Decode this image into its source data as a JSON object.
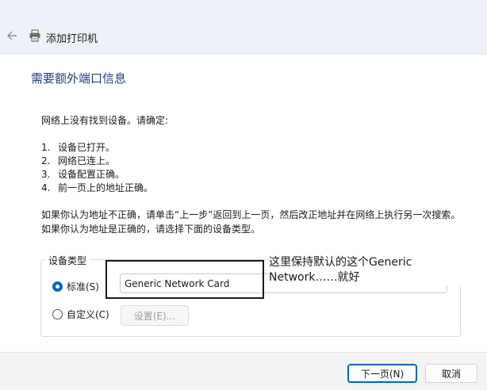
{
  "window": {
    "title": "添加打印机",
    "back_icon": "back-arrow-icon",
    "title_icon": "printer-icon"
  },
  "main": {
    "heading": "需要额外端口信息",
    "intro": "网络上没有找到设备。请确定:",
    "checklist": [
      {
        "num": "1.",
        "text": "设备已打开。"
      },
      {
        "num": "2.",
        "text": "网络已连上。"
      },
      {
        "num": "3.",
        "text": "设备配置正确。"
      },
      {
        "num": "4.",
        "text": "前一页上的地址正确。"
      }
    ],
    "note1": "如果你认为地址不正确，请单击“上一步”返回到上一页，然后改正地址并在网络上执行另一次搜索。",
    "note2": "如果你认为地址是正确的，请选择下面的设备类型。"
  },
  "device_type": {
    "legend": "设备类型",
    "standard_label": "标准(S)",
    "standard_selected": true,
    "standard_value": "Generic Network Card",
    "custom_label": "自定义(C)",
    "custom_selected": false,
    "settings_label": "设置(E)..."
  },
  "annotation": {
    "text": "这里保持默认的这个Generic Network……就好"
  },
  "footer": {
    "next_label": "下一页(N)",
    "cancel_label": "取消"
  },
  "colors": {
    "heading": "#1e3f7a",
    "accent": "#0067c0"
  }
}
